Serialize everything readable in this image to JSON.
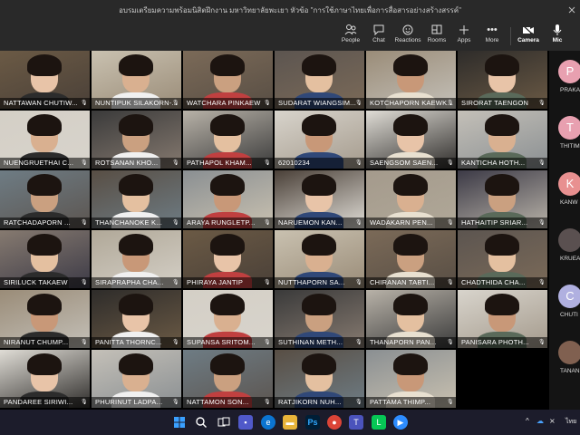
{
  "window": {
    "title": "อบรมเตรียมความพร้อมนิสิตฝึกงาน มหาวิทยาลัยพะเยา หัวข้อ \"การใช้ภาษาไทยเพื่อการสื่อสารอย่างสร้างสรรค์\""
  },
  "toolbar": {
    "people": "People",
    "chat": "Chat",
    "reactions": "Reactions",
    "rooms": "Rooms",
    "apps": "Apps",
    "more": "More",
    "camera": "Camera",
    "mic": "Mic"
  },
  "participants": [
    {
      "name": "NATTAWAN CHUTIW..."
    },
    {
      "name": "NUNTIPUK SILAKORN-..."
    },
    {
      "name": "WATCHARA PINKAEW"
    },
    {
      "name": "SUDARAT WIANGSIM..."
    },
    {
      "name": "KOTCHAPORN KAEWK..."
    },
    {
      "name": "SIRORAT TAENGON"
    },
    {
      "name": "NUENGRUETHAI C..."
    },
    {
      "name": "ROTSANAN KHO..."
    },
    {
      "name": "PATHAPOL KHAM..."
    },
    {
      "name": "62010234"
    },
    {
      "name": "SAENGSOM SAEN..."
    },
    {
      "name": "KANTICHA HOTH..."
    },
    {
      "name": "RATCHADAPORN ..."
    },
    {
      "name": "THANCHANOKE K..."
    },
    {
      "name": "ARAYA RUNGLETP..."
    },
    {
      "name": "NARUEMON KAN..."
    },
    {
      "name": "WADAKARN PEN..."
    },
    {
      "name": "HATHAITIP SRIAR..."
    },
    {
      "name": "SIRILUCK TAKAEW"
    },
    {
      "name": "SIRAPRAPHA CHA..."
    },
    {
      "name": "PHIRAYA JANTIP"
    },
    {
      "name": "NUTTHAPORN SA..."
    },
    {
      "name": "CHIRANAN TABTI..."
    },
    {
      "name": "CHADTHIDA CHA..."
    },
    {
      "name": "NIRANUT CHUMP..."
    },
    {
      "name": "PANITTA THORNC..."
    },
    {
      "name": "SUPANSA SRITOM..."
    },
    {
      "name": "SUTHINAN METH..."
    },
    {
      "name": "THANAPORN PAN..."
    },
    {
      "name": "PANISARA PHOTH..."
    },
    {
      "name": "PANDAREE SIRIWI..."
    },
    {
      "name": "PHURINUT LADPA..."
    },
    {
      "name": "NATTAMON SON..."
    },
    {
      "name": "RATJIKORN NUH..."
    },
    {
      "name": "PATTAMA THIMP..."
    }
  ],
  "roster": [
    {
      "initial": "P",
      "name": "PRAKA",
      "color": "#e8a0b0"
    },
    {
      "initial": "T",
      "name": "THITIM",
      "color": "#e8a0b0"
    },
    {
      "initial": "K",
      "name": "KANW",
      "color": "#e89090"
    },
    {
      "initial": "",
      "name": "KRUEA",
      "color": "#5a5050"
    },
    {
      "initial": "C",
      "name": "CHUTI",
      "color": "#b0b0e0"
    },
    {
      "initial": "",
      "name": "TANAN",
      "color": "#806050"
    }
  ],
  "tray": {
    "language": "ไทย"
  }
}
